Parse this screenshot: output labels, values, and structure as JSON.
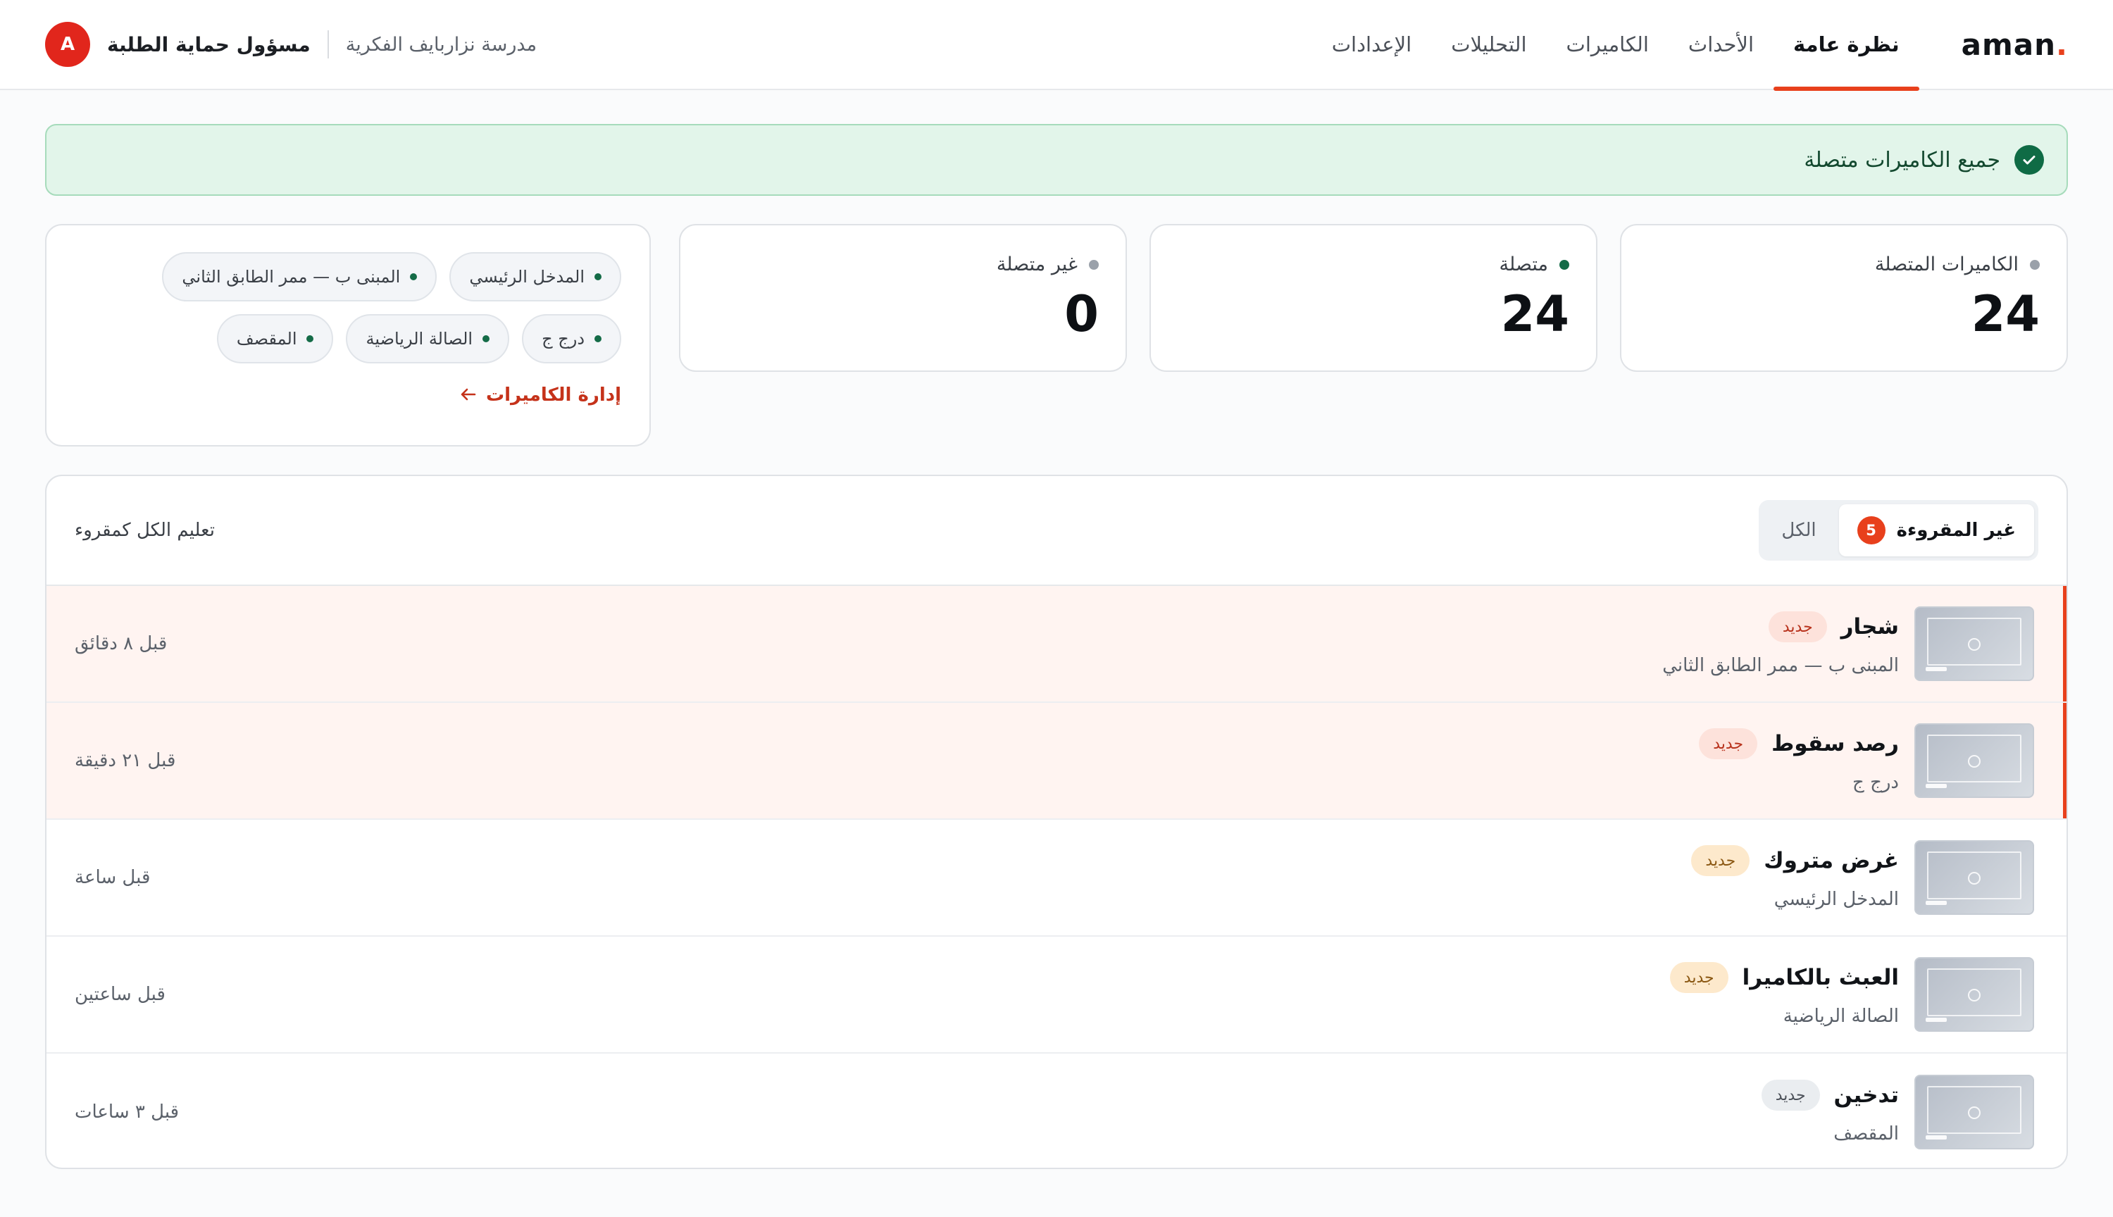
{
  "brand": {
    "name": "aman",
    "dot": "."
  },
  "nav": [
    {
      "label": "نظرة عامة",
      "active": true
    },
    {
      "label": "الأحداث"
    },
    {
      "label": "الكاميرات"
    },
    {
      "label": "التحليلات"
    },
    {
      "label": "الإعدادات"
    }
  ],
  "user": {
    "school": "مدرسة نزاربايف الفكرية",
    "role": "مسؤول حماية الطلبة",
    "avatar_initial": "A"
  },
  "banner": {
    "text": "جميع الكاميرات متصلة",
    "icon": "check-circle-icon"
  },
  "stats": [
    {
      "label": "الكاميرات المتصلة",
      "value": "24",
      "dot_color": "#9aa1aa"
    },
    {
      "label": "متصلة",
      "value": "24",
      "dot_color": "#146b47"
    },
    {
      "label": "غير متصلة",
      "value": "0",
      "dot_color": "#9aa1aa"
    }
  ],
  "locations": {
    "chips": [
      "المدخل الرئيسي",
      "المبنى ب — ممر الطابق الثاني",
      "درج ج",
      "الصالة الرياضية",
      "المقصف"
    ],
    "manage_label": "إدارة الكاميرات"
  },
  "events": {
    "tabs": {
      "all": "الكل",
      "unread": "غير المقروءة",
      "unread_count": "5"
    },
    "mark_all": "تعليم الكل كمقروء",
    "rows": [
      {
        "title": "شجار",
        "tag": "جديد",
        "location": "المبنى ب — ممر الطابق الثاني",
        "time": "قبل ٨ دقائق"
      },
      {
        "title": "رصد سقوط",
        "tag": "جديد",
        "location": "درج ج",
        "time": "قبل ٢١ دقيقة"
      },
      {
        "title": "غرض متروك",
        "tag": "جديد",
        "location": "المدخل الرئيسي",
        "time": "قبل ساعة"
      },
      {
        "title": "العبث بالكاميرا",
        "tag": "جديد",
        "location": "الصالة الرياضية",
        "time": "قبل ساعتين"
      },
      {
        "title": "تدخين",
        "tag": "جديد",
        "location": "المقصف",
        "time": "قبل ٣ ساعات"
      }
    ]
  },
  "colors": {
    "accent": "#e8401c",
    "success": "#0f6b45",
    "banner_bg": "#e2f5ea"
  }
}
